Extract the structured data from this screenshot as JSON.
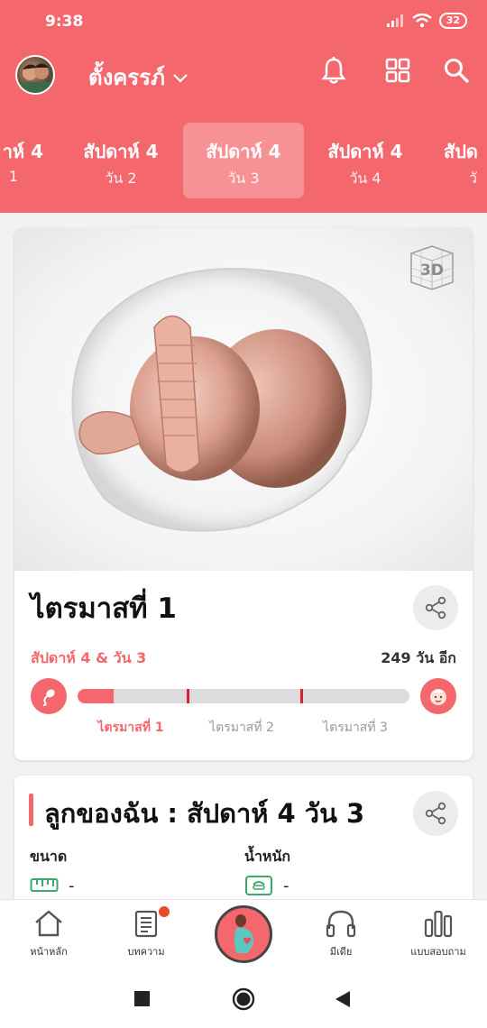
{
  "status_bar": {
    "time": "9:38",
    "battery": "32"
  },
  "header": {
    "username": "ตั้งครรภ์",
    "tabs": [
      {
        "week": "าห์ 4",
        "day": "1"
      },
      {
        "week": "สัปดาห์ 4",
        "day": "วัน 2"
      },
      {
        "week": "สัปดาห์ 4",
        "day": "วัน 3",
        "active": true
      },
      {
        "week": "สัปดาห์ 4",
        "day": "วัน 4"
      },
      {
        "week": "สัปด",
        "day": "วั"
      }
    ]
  },
  "trimester_card": {
    "badge_3d": "3D",
    "title": "ไตรมาสที่ 1",
    "week_day": "สัปดาห์ 4 & วัน 3",
    "remaining": "249 วัน อีก",
    "progress": 0.11,
    "dividers": [
      0.33,
      0.67
    ],
    "trimesters": [
      "ไตรมาสที่ 1",
      "ไตรมาสที่ 2",
      "ไตรมาสที่ 3"
    ]
  },
  "baby_card": {
    "title": "ลูกของฉัน : สัปดาห์ 4 วัน 3",
    "size_label": "ขนาด",
    "size_value": "-",
    "weight_label": "น้ำหนัก",
    "weight_value": "-"
  },
  "bottom_nav": {
    "home": "หน้าหลัก",
    "articles": "บทความ",
    "media": "มีเดีย",
    "survey": "แบบสอบถาม"
  },
  "colors": {
    "accent": "#f4676d",
    "divider": "#d9222e"
  }
}
